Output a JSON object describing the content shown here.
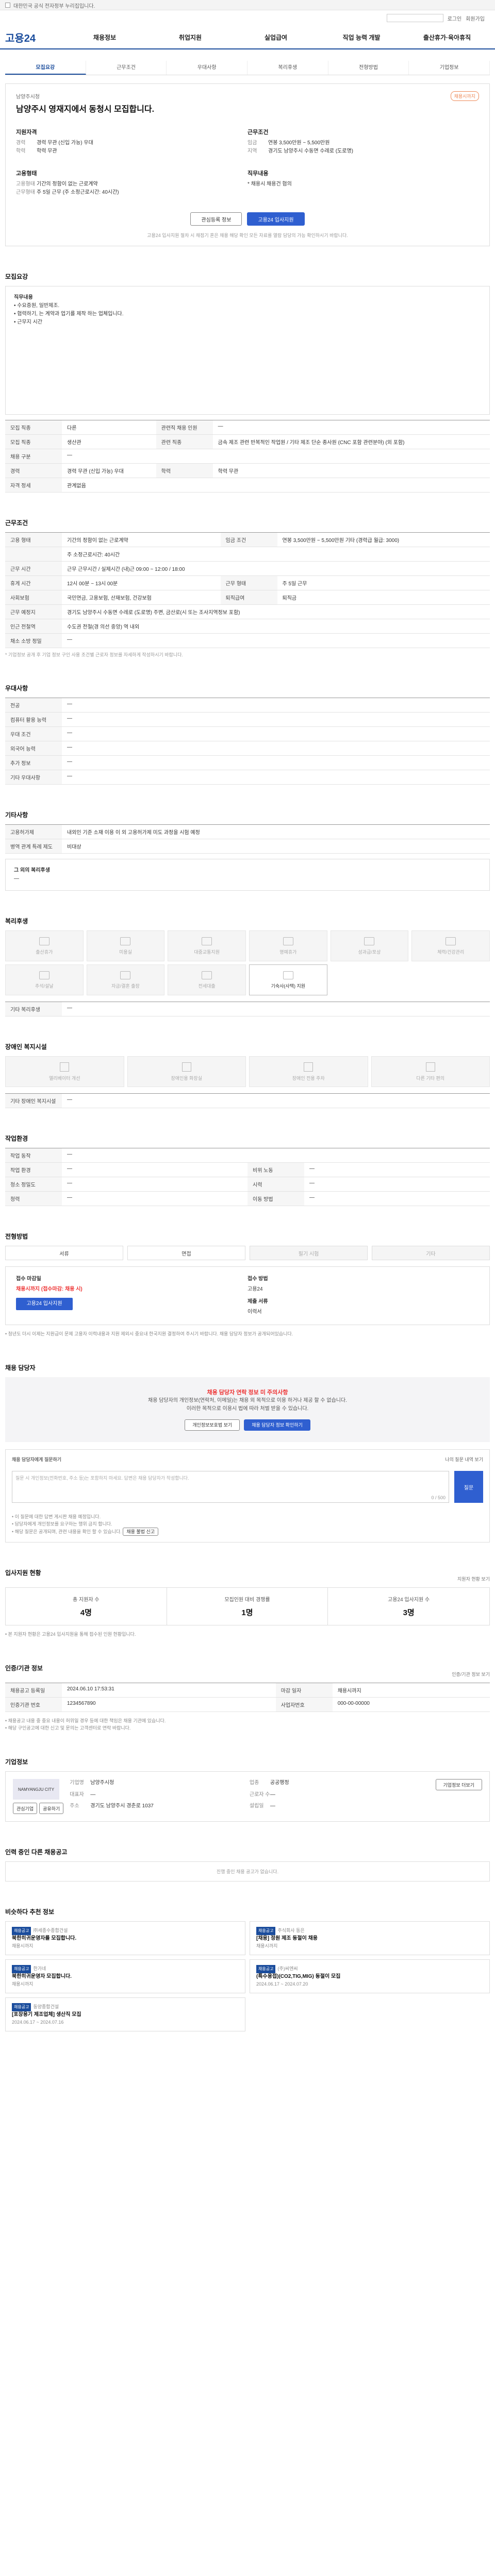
{
  "topbar": {
    "notice": "대한민국 공식 전자정부 누리집입니다."
  },
  "util": {
    "login": "로그인",
    "join": "회원가입"
  },
  "gnb": {
    "logo": "고용24",
    "items": [
      "채용정보",
      "취업지원",
      "실업급여",
      "직업 능력 개발",
      "출산휴가·육아휴직"
    ]
  },
  "tabs": [
    "모집요강",
    "근무조건",
    "우대사항",
    "복리후생",
    "전형방법",
    "기업정보"
  ],
  "hero": {
    "company": "남양주시청",
    "title": "남양주시 영재지에서 동청시 모집합니다.",
    "badge": "채용시까지",
    "left": {
      "title": "지원자격",
      "rows": [
        {
          "k": "경력",
          "v": "경력 무관 (신입 가능) 우대"
        },
        {
          "k": "학력",
          "v": "학력 무관"
        }
      ]
    },
    "left2": {
      "title": "고용형태",
      "rows": [
        {
          "k": "고용형태",
          "v": "기간의 정함이 없는 근로계약"
        },
        {
          "k": "근무형태",
          "v": "주 5일 근무 (주 소정근로시간: 40시간)"
        }
      ]
    },
    "right": {
      "title": "근무조건",
      "rows": [
        {
          "k": "임금",
          "v": "연봉 3,500만원 ~ 5,500만원"
        },
        {
          "k": "지역",
          "v": "경기도 남양주시 수동면 수레로 (도로명)"
        }
      ]
    },
    "right2": {
      "title": "직무내용",
      "rows": [
        {
          "k": "",
          "v": "* 채용시 채용건 협의"
        }
      ]
    },
    "btn_scrap": "관심등록 정보",
    "btn_apply": "고용24 입사지원",
    "note": "고용24 입사지원 절차 시 채점기 혼은 채용 해당 확인 모든 자료를 열람 담당의 가능 확인하시기 바랍니다."
  },
  "recruit": {
    "title": "모집요강",
    "box_title": "직무내용",
    "box_lines": [
      "• 수요증원, 일반제조.",
      "• 협력하기, 는 계약과 업기를 제작 하는 업체입니다.",
      "• 근무지 시간"
    ],
    "rows": [
      {
        "k": "모집 직종",
        "v": "다른",
        "k2": "관련직 채용 인원",
        "v2": "—"
      },
      {
        "k": "모집 직종",
        "v": "생산관",
        "k2": "관련 직종",
        "v2": "금속 제조 관련 반복적인 작업원 / 기타 제조 단순 종사원 (CNC 포함 관련분야) (외 포함)"
      },
      {
        "k": "채용 구분",
        "v": "—",
        "k2": "",
        "v2": ""
      },
      {
        "k": "경력",
        "v": "경력 무관 (신입 가능) 우대",
        "k2": "학력",
        "v2": "학력 무관"
      },
      {
        "k": "자격 정세",
        "v": "관계없음",
        "k2": "",
        "v2": ""
      }
    ]
  },
  "work": {
    "title": "근무조건",
    "rows": [
      {
        "k": "고용 형태",
        "v": "기간의 정함이 없는 근로계약",
        "k2": "임금 조건",
        "v2": "연봉 3,500만원 ~ 5,500만원 기타 (경력급 월급: 3000)"
      },
      {
        "k": "",
        "v": "주 소정근로시간: 40시간",
        "k2": "",
        "v2": ""
      },
      {
        "k": "근무 시간",
        "v": "근무 근무시간 / 실제시간 (내)근 09:00 ~ 12:00 / 18:00",
        "k2": "",
        "v2": ""
      },
      {
        "k": "휴게 시간",
        "v": "12시 00분 ~ 13시 00분",
        "k2": "근무 형태",
        "v2": "주 5일 근무"
      },
      {
        "k": "사회보험",
        "v": "국민연금, 고용보험, 산재보험, 건강보험",
        "k2": "퇴직급여",
        "v2": "퇴직금"
      },
      {
        "k": "근무 예정지",
        "v": "경기도 남양주시 수동면 수레로 (도로명) 주변, 금산로(시 또는 조사지역정보 포함)",
        "k2": "",
        "v2": ""
      },
      {
        "k": "인근 전철역",
        "v": "수도권 전철(경 의선 중앙) 역 내외",
        "k2": "",
        "v2": ""
      },
      {
        "k": "채소 소방 정밀",
        "v": "—",
        "k2": "",
        "v2": ""
      }
    ],
    "note": "* 기업정보 공개 후 기업 정보 구인 사용 조건별 근로자 정보를 자세하게 작성하시기 바랍니다."
  },
  "pref": {
    "title": "우대사항",
    "rows": [
      {
        "k": "전공",
        "v": "—"
      },
      {
        "k": "컴퓨터 활용 능력",
        "v": "—"
      },
      {
        "k": "우대 조건",
        "v": "—"
      },
      {
        "k": "외국어 능력",
        "v": "—"
      },
      {
        "k": "추가 정보",
        "v": "—"
      },
      {
        "k": "기타 우대사항",
        "v": "—"
      }
    ]
  },
  "etc": {
    "title": "기타사항",
    "rows": [
      {
        "k": "고용허가제",
        "v": "내외인 기준 소재 이용 이 외 고용허가제 미도 과정을 시험 예정"
      },
      {
        "k": "병역 관계 특례 제도",
        "v": "비대상"
      },
      {
        "k": "",
        "v": ""
      },
      {
        "k": "그 외의 복리후생",
        "v": "—"
      }
    ]
  },
  "welfare": {
    "title": "복리후생",
    "items": [
      "출산휴가",
      "미용실",
      "대중교통지원",
      "명예휴가",
      "성과급/포상",
      "체력/건강관리",
      "추석/설날",
      "자금/결혼 출장",
      "전세대출",
      "기숙사(사택) 지원"
    ],
    "on_index": 9,
    "extra_label": "기타 복리후생",
    "extra_value": "—"
  },
  "disability": {
    "title": "장애인 복지시설",
    "items": [
      "엘리베이터 개선",
      "장애인용 화장실",
      "장애인 전용 주차",
      "다른 기타 편의"
    ],
    "extra_label": "기타 장애인 복지시설",
    "extra_value": "—"
  },
  "env": {
    "title": "작업환경",
    "rows": [
      {
        "k": "작업 동작",
        "v": "—",
        "k2": "",
        "v2": ""
      },
      {
        "k": "작업 환경",
        "v": "—",
        "k2": "비위 노동",
        "v2": "—"
      },
      {
        "k": "청소 정밀도",
        "v": "—",
        "k2": "시력",
        "v2": "—"
      },
      {
        "k": "청력",
        "v": "—",
        "k2": "이동 방법",
        "v2": "—"
      }
    ]
  },
  "process": {
    "title": "전형방법",
    "steps": [
      "서류",
      "면접",
      "필기 시험",
      "기타"
    ],
    "apply_title": "접수 마감일",
    "apply_date": "채용시까지 (접수마감: 채용 시)",
    "apply_btn": "고용24 입사지원",
    "method_title": "접수 방법",
    "method_value": "고용24",
    "doc_title": "제출 서류",
    "doc_value": "이력서",
    "notice": "• 청년도 더시 이제는 지원급이 문제 고용자 이력내용과 지원 제외시 중요내 한국지원 결정하여 주시기 바랍니다. 채용 담당자 정보가 공개되어있습니다."
  },
  "manager": {
    "title": "채용 담당자",
    "warn": "채용 담당자 연락 정보 미 주의사항",
    "text": "채용 담당자의 개인정보(연락처, 이메일)는 채용 외 목적으로 이용 하거나 제공 할 수 없습니다.",
    "text2": "이러한 목적으로 이용시 법에 따라 처벌 받을 수 있습니다.",
    "btn1": "개인정보보호법 보기",
    "btn2": "채용 담당자 정보 확인하기"
  },
  "question": {
    "title": "채용 담당자에게 질문하기",
    "count_label": "나의 질문 내역 보기",
    "placeholder": "질문 시 개인정보(전화번호, 주소 등)는 포함하지 마세요. 답변은 채용 담당자가 작성합니다.",
    "counter": "0 / 500",
    "submit": "질문",
    "notes": [
      "• 이 질문에 대한 답변 게시판 채용 예정입니다.",
      "• 담당자에게 개인정보를 요구하는 행위 금지 합니다.",
      "• 해당 질문은 공개되며, 관련 내용을 확인 할 수 있습니다."
    ],
    "report": "채용 불법 신고"
  },
  "stats": {
    "title": "입사지원 현황",
    "more": "지원자 현황 보기",
    "items": [
      {
        "label": "총 지원자 수",
        "value": "4명"
      },
      {
        "label": "모집인원 대비 경쟁률",
        "value": "1명"
      },
      {
        "label": "고용24 입사지원 수",
        "value": "3명"
      }
    ],
    "note": "• 본 지원자 현황은 고용24 입사지원을 통해 접수된 인원 현황입니다."
  },
  "reg": {
    "title": "인증/기관 정보",
    "more": "인증/기관 정보 보기",
    "rows": [
      {
        "k": "채용공고 등록일",
        "v": "2024.06.10 17:53:31",
        "k2": "마감 일자",
        "v2": "채용시까지"
      },
      {
        "k": "인증기관 번호",
        "v": "1234567890",
        "k2": "사업자번호",
        "v2": "000-00-00000"
      }
    ],
    "notes": [
      "• 채용공고 내용 중 중요 내용이 허위일 경우 등에 대한 책임은 채용 기관에 있습니다.",
      "• 해당 구인공고에 대한 신고 및 문의는 고객센터로 연락 바랍니다."
    ]
  },
  "corp": {
    "title": "기업정보",
    "logo_text": "NAMYANGJU CITY",
    "btn_follow": "관심기업",
    "btn_share": "공유하기",
    "btn_detail": "기업정보 더보기",
    "info": [
      {
        "k": "기업명",
        "v": "남양주시청"
      },
      {
        "k": "업종",
        "v": "공공행정"
      },
      {
        "k": "대표자",
        "v": "—"
      },
      {
        "k": "근로자 수",
        "v": "—"
      },
      {
        "k": "주소",
        "v": "경기도 남양주시 경춘로 1037"
      },
      {
        "k": "설립일",
        "v": "—"
      }
    ]
  },
  "other": {
    "title": "인력 중인 다른 채용공고",
    "empty": "진행 중인 채용 공고가 없습니다."
  },
  "similar": {
    "title": "비슷하다 추천 정보",
    "items": [
      {
        "tag": "채용공고",
        "company": "㈜세종수종합건설",
        "title": "북한히귀운영자를 모집합니다.",
        "meta": "채용시까지"
      },
      {
        "tag": "채용공고",
        "company": "주식회사 동은",
        "title": "[채용] 정원 제조 동절이 채용",
        "meta": "채용시까지"
      },
      {
        "tag": "채용공고",
        "company": "한가네",
        "title": "북한히귀운영자 모집합니다.",
        "meta": "채용시까지"
      },
      {
        "tag": "채용공고",
        "company": "(주)씨엔씨",
        "title": "(특수용접)(CO2,TIG,MIG) 동절이 모집",
        "meta": "2024.06.17 ~ 2024.07.20"
      },
      {
        "tag": "채용공고",
        "company": "동양종합건설",
        "title": "[포장용기 제조업체] 생산직 모집",
        "meta": "2024.06.17 ~ 2024.07.16"
      }
    ]
  }
}
